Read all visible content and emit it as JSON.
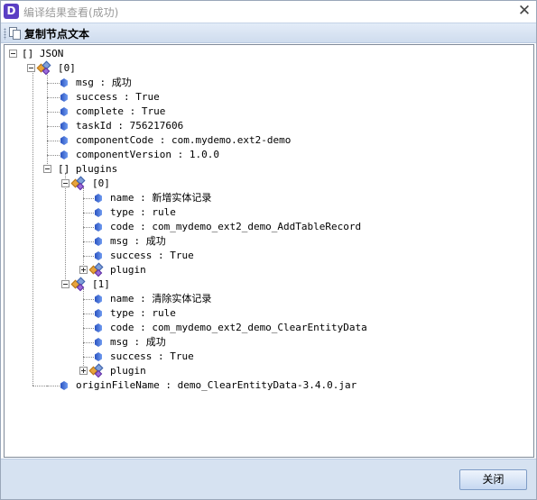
{
  "window": {
    "app_icon_letter": "D",
    "title": "编译结果查看(成功)",
    "close_glyph": "✕"
  },
  "toolbar": {
    "copy_label": "复制节点文本"
  },
  "tree": {
    "root": "[] JSON",
    "item0": "[0]",
    "msg": "msg : 成功",
    "success": "success : True",
    "complete": "complete : True",
    "taskId": "taskId : 756217606",
    "componentCode": "componentCode : com.mydemo.ext2-demo",
    "componentVersion": "componentVersion : 1.0.0",
    "plugins": "[] plugins",
    "p0": "[0]",
    "p0_name": "name : 新增实体记录",
    "p0_type": "type : rule",
    "p0_code": "code : com_mydemo_ext2_demo_AddTableRecord",
    "p0_msg": "msg : 成功",
    "p0_success": "success : True",
    "p0_plugin": "plugin",
    "p1": "[1]",
    "p1_name": "name : 清除实体记录",
    "p1_type": "type : rule",
    "p1_code": "code : com_mydemo_ext2_demo_ClearEntityData",
    "p1_msg": "msg : 成功",
    "p1_success": "success : True",
    "p1_plugin": "plugin",
    "originFileName": "originFileName : demo_ClearEntityData-3.4.0.jar"
  },
  "footer": {
    "close_label": "关闭"
  }
}
